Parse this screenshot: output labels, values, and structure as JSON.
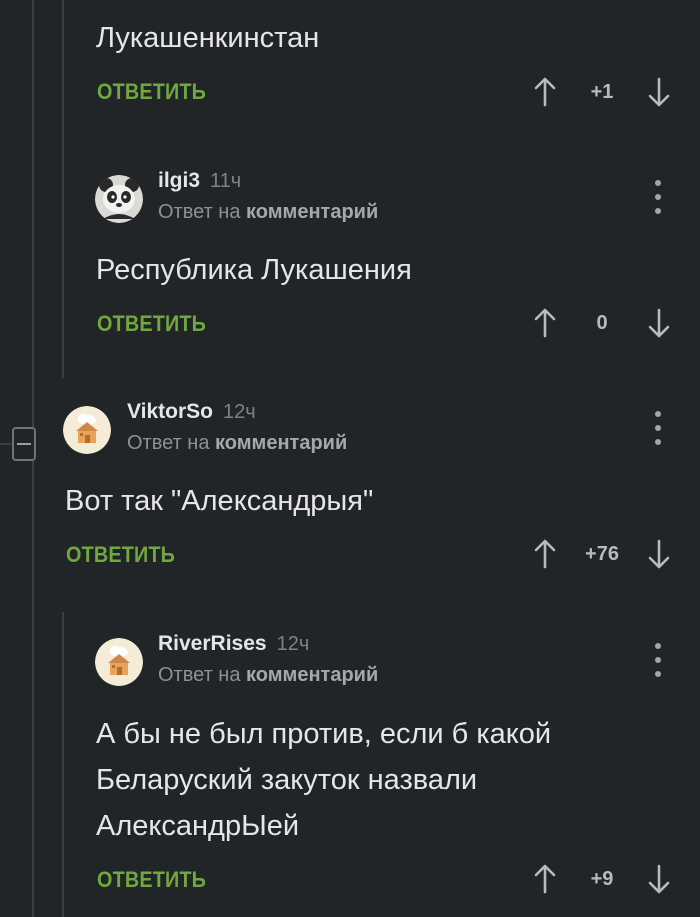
{
  "comments": [
    {
      "text": "Лукашенкинстан",
      "reply_label": "ОТВЕТИТЬ",
      "score": "+1"
    },
    {
      "author": "ilgi3",
      "time": "11ч",
      "reply_to_prefix": "Ответ на",
      "reply_to_target": "комментарий",
      "text": "Республика Лукашения",
      "reply_label": "ОТВЕТИТЬ",
      "score": "0",
      "avatar": "panda-avatar"
    },
    {
      "author": "ViktorSo",
      "time": "12ч",
      "reply_to_prefix": "Ответ на",
      "reply_to_target": "комментарий",
      "text": "Вот так \"Александрыя\"",
      "reply_label": "ОТВЕТИТЬ",
      "score": "+76",
      "avatar": "default-house-avatar"
    },
    {
      "author": "RiverRises",
      "time": "12ч",
      "reply_to_prefix": "Ответ на",
      "reply_to_target": "комментарий",
      "text": "А бы не был против, если б какой\nБеларуский закуток назвали\nАлександрЫей",
      "reply_label": "ОТВЕТИТЬ",
      "score": "+9",
      "avatar": "default-house-avatar"
    }
  ],
  "colors": {
    "background": "#222527",
    "reply_accent": "#6fa83f",
    "text": "#e6e6e6",
    "muted": "#8c9194"
  },
  "icons": {
    "upvote": "arrow-up-icon",
    "downvote": "arrow-down-icon",
    "menu": "more-vertical-icon",
    "collapse": "collapse-minus-icon"
  }
}
